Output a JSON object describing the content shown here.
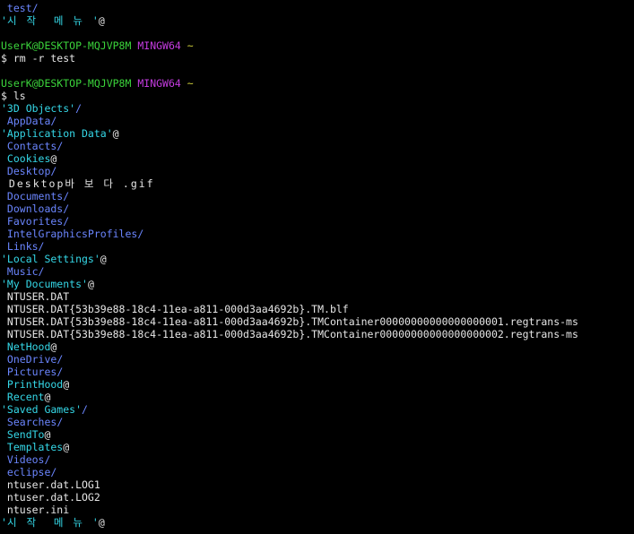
{
  "terminal": {
    "colors": {
      "background": "#000000",
      "text": "#e6e6e6",
      "directory": "#6b86ff",
      "link": "#35d8e8",
      "user": "#3bd33b",
      "system": "#c43ce0",
      "path": "#cfcf3a"
    },
    "lines": [
      {
        "segs": [
          {
            "t": " test",
            "c": "dir"
          },
          {
            "t": "/",
            "c": "dir"
          }
        ]
      },
      {
        "segs": [
          {
            "t": "'",
            "c": "quote"
          },
          {
            "t": "시 작  메 뉴 ",
            "c": "link"
          },
          {
            "t": "'",
            "c": "quote"
          },
          {
            "t": "@",
            "c": "suffix"
          }
        ]
      },
      {
        "segs": []
      },
      {
        "segs": [
          {
            "t": "UserK@DESKTOP-MQJVP8M",
            "c": "user"
          },
          {
            "t": " ",
            "c": "file"
          },
          {
            "t": "MINGW64",
            "c": "system"
          },
          {
            "t": " ",
            "c": "file"
          },
          {
            "t": "~",
            "c": "path"
          }
        ]
      },
      {
        "segs": [
          {
            "t": "$ rm -r test",
            "c": "prompt"
          }
        ]
      },
      {
        "segs": []
      },
      {
        "segs": [
          {
            "t": "UserK@DESKTOP-MQJVP8M",
            "c": "user"
          },
          {
            "t": " ",
            "c": "file"
          },
          {
            "t": "MINGW64",
            "c": "system"
          },
          {
            "t": " ",
            "c": "file"
          },
          {
            "t": "~",
            "c": "path"
          }
        ]
      },
      {
        "segs": [
          {
            "t": "$ ls",
            "c": "prompt"
          }
        ]
      },
      {
        "segs": [
          {
            "t": "'3D Objects'",
            "c": "link"
          },
          {
            "t": "/",
            "c": "dir"
          }
        ]
      },
      {
        "segs": [
          {
            "t": " AppData",
            "c": "dir"
          },
          {
            "t": "/",
            "c": "dir"
          }
        ]
      },
      {
        "segs": [
          {
            "t": "'Application Data'",
            "c": "link"
          },
          {
            "t": "@",
            "c": "suffix"
          }
        ]
      },
      {
        "segs": [
          {
            "t": " Contacts",
            "c": "dir"
          },
          {
            "t": "/",
            "c": "dir"
          }
        ]
      },
      {
        "segs": [
          {
            "t": " Cookies",
            "c": "link"
          },
          {
            "t": "@",
            "c": "suffix"
          }
        ]
      },
      {
        "segs": [
          {
            "t": " Desktop",
            "c": "dir"
          },
          {
            "t": "/",
            "c": "dir"
          }
        ]
      },
      {
        "segs": [
          {
            "t": " Desktop바 보 다 .gif",
            "c": "file"
          }
        ]
      },
      {
        "segs": [
          {
            "t": " Documents",
            "c": "dir"
          },
          {
            "t": "/",
            "c": "dir"
          }
        ]
      },
      {
        "segs": [
          {
            "t": " Downloads",
            "c": "dir"
          },
          {
            "t": "/",
            "c": "dir"
          }
        ]
      },
      {
        "segs": [
          {
            "t": " Favorites",
            "c": "dir"
          },
          {
            "t": "/",
            "c": "dir"
          }
        ]
      },
      {
        "segs": [
          {
            "t": " IntelGraphicsProfiles",
            "c": "dir"
          },
          {
            "t": "/",
            "c": "dir"
          }
        ]
      },
      {
        "segs": [
          {
            "t": " Links",
            "c": "dir"
          },
          {
            "t": "/",
            "c": "dir"
          }
        ]
      },
      {
        "segs": [
          {
            "t": "'Local Settings'",
            "c": "link"
          },
          {
            "t": "@",
            "c": "suffix"
          }
        ]
      },
      {
        "segs": [
          {
            "t": " Music",
            "c": "dir"
          },
          {
            "t": "/",
            "c": "dir"
          }
        ]
      },
      {
        "segs": [
          {
            "t": "'My Documents'",
            "c": "link"
          },
          {
            "t": "@",
            "c": "suffix"
          }
        ]
      },
      {
        "segs": [
          {
            "t": " NTUSER.DAT",
            "c": "file"
          }
        ]
      },
      {
        "segs": [
          {
            "t": " NTUSER.DAT{53b39e88-18c4-11ea-a811-000d3aa4692b}.TM.blf",
            "c": "file"
          }
        ]
      },
      {
        "segs": [
          {
            "t": " NTUSER.DAT{53b39e88-18c4-11ea-a811-000d3aa4692b}.TMContainer00000000000000000001.regtrans-ms",
            "c": "file"
          }
        ]
      },
      {
        "segs": [
          {
            "t": " NTUSER.DAT{53b39e88-18c4-11ea-a811-000d3aa4692b}.TMContainer00000000000000000002.regtrans-ms",
            "c": "file"
          }
        ]
      },
      {
        "segs": [
          {
            "t": " NetHood",
            "c": "link"
          },
          {
            "t": "@",
            "c": "suffix"
          }
        ]
      },
      {
        "segs": [
          {
            "t": " OneDrive",
            "c": "dir"
          },
          {
            "t": "/",
            "c": "dir"
          }
        ]
      },
      {
        "segs": [
          {
            "t": " Pictures",
            "c": "dir"
          },
          {
            "t": "/",
            "c": "dir"
          }
        ]
      },
      {
        "segs": [
          {
            "t": " PrintHood",
            "c": "link"
          },
          {
            "t": "@",
            "c": "suffix"
          }
        ]
      },
      {
        "segs": [
          {
            "t": " Recent",
            "c": "link"
          },
          {
            "t": "@",
            "c": "suffix"
          }
        ]
      },
      {
        "segs": [
          {
            "t": "'Saved Games'",
            "c": "link"
          },
          {
            "t": "/",
            "c": "dir"
          }
        ]
      },
      {
        "segs": [
          {
            "t": " Searches",
            "c": "dir"
          },
          {
            "t": "/",
            "c": "dir"
          }
        ]
      },
      {
        "segs": [
          {
            "t": " SendTo",
            "c": "link"
          },
          {
            "t": "@",
            "c": "suffix"
          }
        ]
      },
      {
        "segs": [
          {
            "t": " Templates",
            "c": "link"
          },
          {
            "t": "@",
            "c": "suffix"
          }
        ]
      },
      {
        "segs": [
          {
            "t": " Videos",
            "c": "dir"
          },
          {
            "t": "/",
            "c": "dir"
          }
        ]
      },
      {
        "segs": [
          {
            "t": " eclipse",
            "c": "dir"
          },
          {
            "t": "/",
            "c": "dir"
          }
        ]
      },
      {
        "segs": [
          {
            "t": " ntuser.dat.LOG1",
            "c": "file"
          }
        ]
      },
      {
        "segs": [
          {
            "t": " ntuser.dat.LOG2",
            "c": "file"
          }
        ]
      },
      {
        "segs": [
          {
            "t": " ntuser.ini",
            "c": "file"
          }
        ]
      },
      {
        "segs": [
          {
            "t": "'",
            "c": "quote"
          },
          {
            "t": "시 작  메 뉴 ",
            "c": "link"
          },
          {
            "t": "'",
            "c": "quote"
          },
          {
            "t": "@",
            "c": "suffix"
          }
        ]
      }
    ]
  }
}
